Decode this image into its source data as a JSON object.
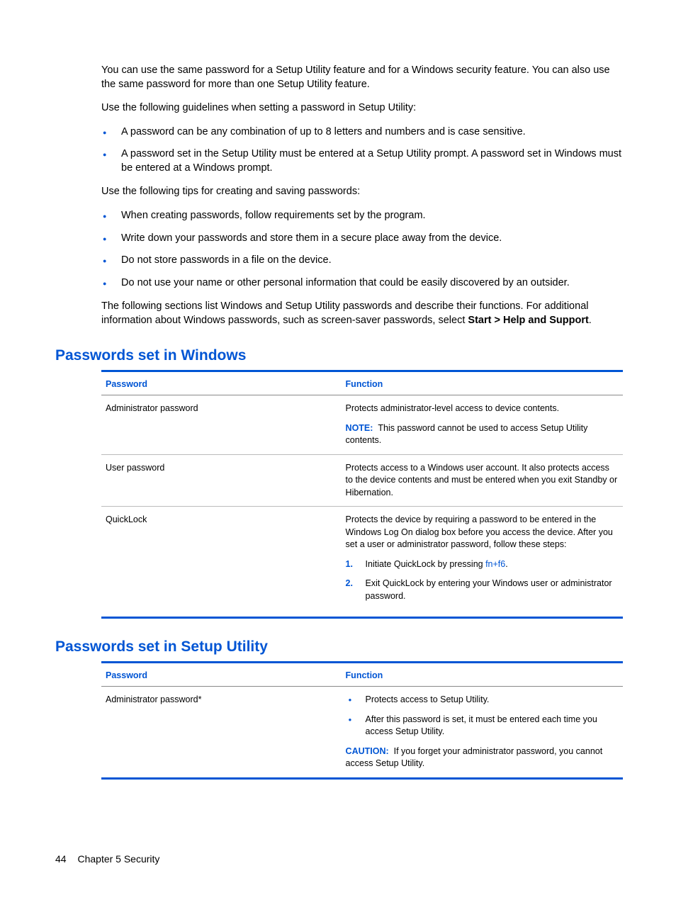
{
  "intro": {
    "p1": "You can use the same password for a Setup Utility feature and for a Windows security feature. You can also use the same password for more than one Setup Utility feature.",
    "p2": "Use the following guidelines when setting a password in Setup Utility:",
    "bullets1": [
      "A password can be any combination of up to 8 letters and numbers and is case sensitive.",
      "A password set in the Setup Utility must be entered at a Setup Utility prompt. A password set in Windows must be entered at a Windows prompt."
    ],
    "p3": "Use the following tips for creating and saving passwords:",
    "bullets2": [
      "When creating passwords, follow requirements set by the program.",
      "Write down your passwords and store them in a secure place away from the device.",
      "Do not store passwords in a file on the device.",
      "Do not use your name or other personal information that could be easily discovered by an outsider."
    ],
    "p4a": "The following sections list Windows and Setup Utility passwords and describe their functions. For additional information about Windows passwords, such as screen-saver passwords, select ",
    "p4b": "Start > Help and Support",
    "p4c": "."
  },
  "section1": {
    "title": "Passwords set in Windows",
    "headers": {
      "c1": "Password",
      "c2": "Function"
    },
    "rows": [
      {
        "name": "Administrator password",
        "desc": "Protects administrator-level access to device contents.",
        "note_label": "NOTE:",
        "note": "This password cannot be used to access Setup Utility contents."
      },
      {
        "name": "User password",
        "desc": "Protects access to a Windows user account. It also protects access to the device contents and must be entered when you exit Standby or Hibernation."
      },
      {
        "name": "QuickLock",
        "desc": "Protects the device by requiring a password to be entered in the Windows Log On dialog box before you access the device. After you set a user or administrator password, follow these steps:",
        "step1a": "Initiate QuickLock by pressing ",
        "step1b": "fn+f6",
        "step1c": ".",
        "step2": "Exit QuickLock by entering your Windows user or administrator password."
      }
    ]
  },
  "section2": {
    "title": "Passwords set in Setup Utility",
    "headers": {
      "c1": "Password",
      "c2": "Function"
    },
    "rows": [
      {
        "name": "Administrator password*",
        "b1": "Protects access to Setup Utility.",
        "b2": "After this password is set, it must be entered each time you access Setup Utility.",
        "caution_label": "CAUTION:",
        "caution": "If you forget your administrator password, you cannot access Setup Utility."
      }
    ]
  },
  "footer": {
    "page": "44",
    "chapter": "Chapter 5   Security"
  }
}
